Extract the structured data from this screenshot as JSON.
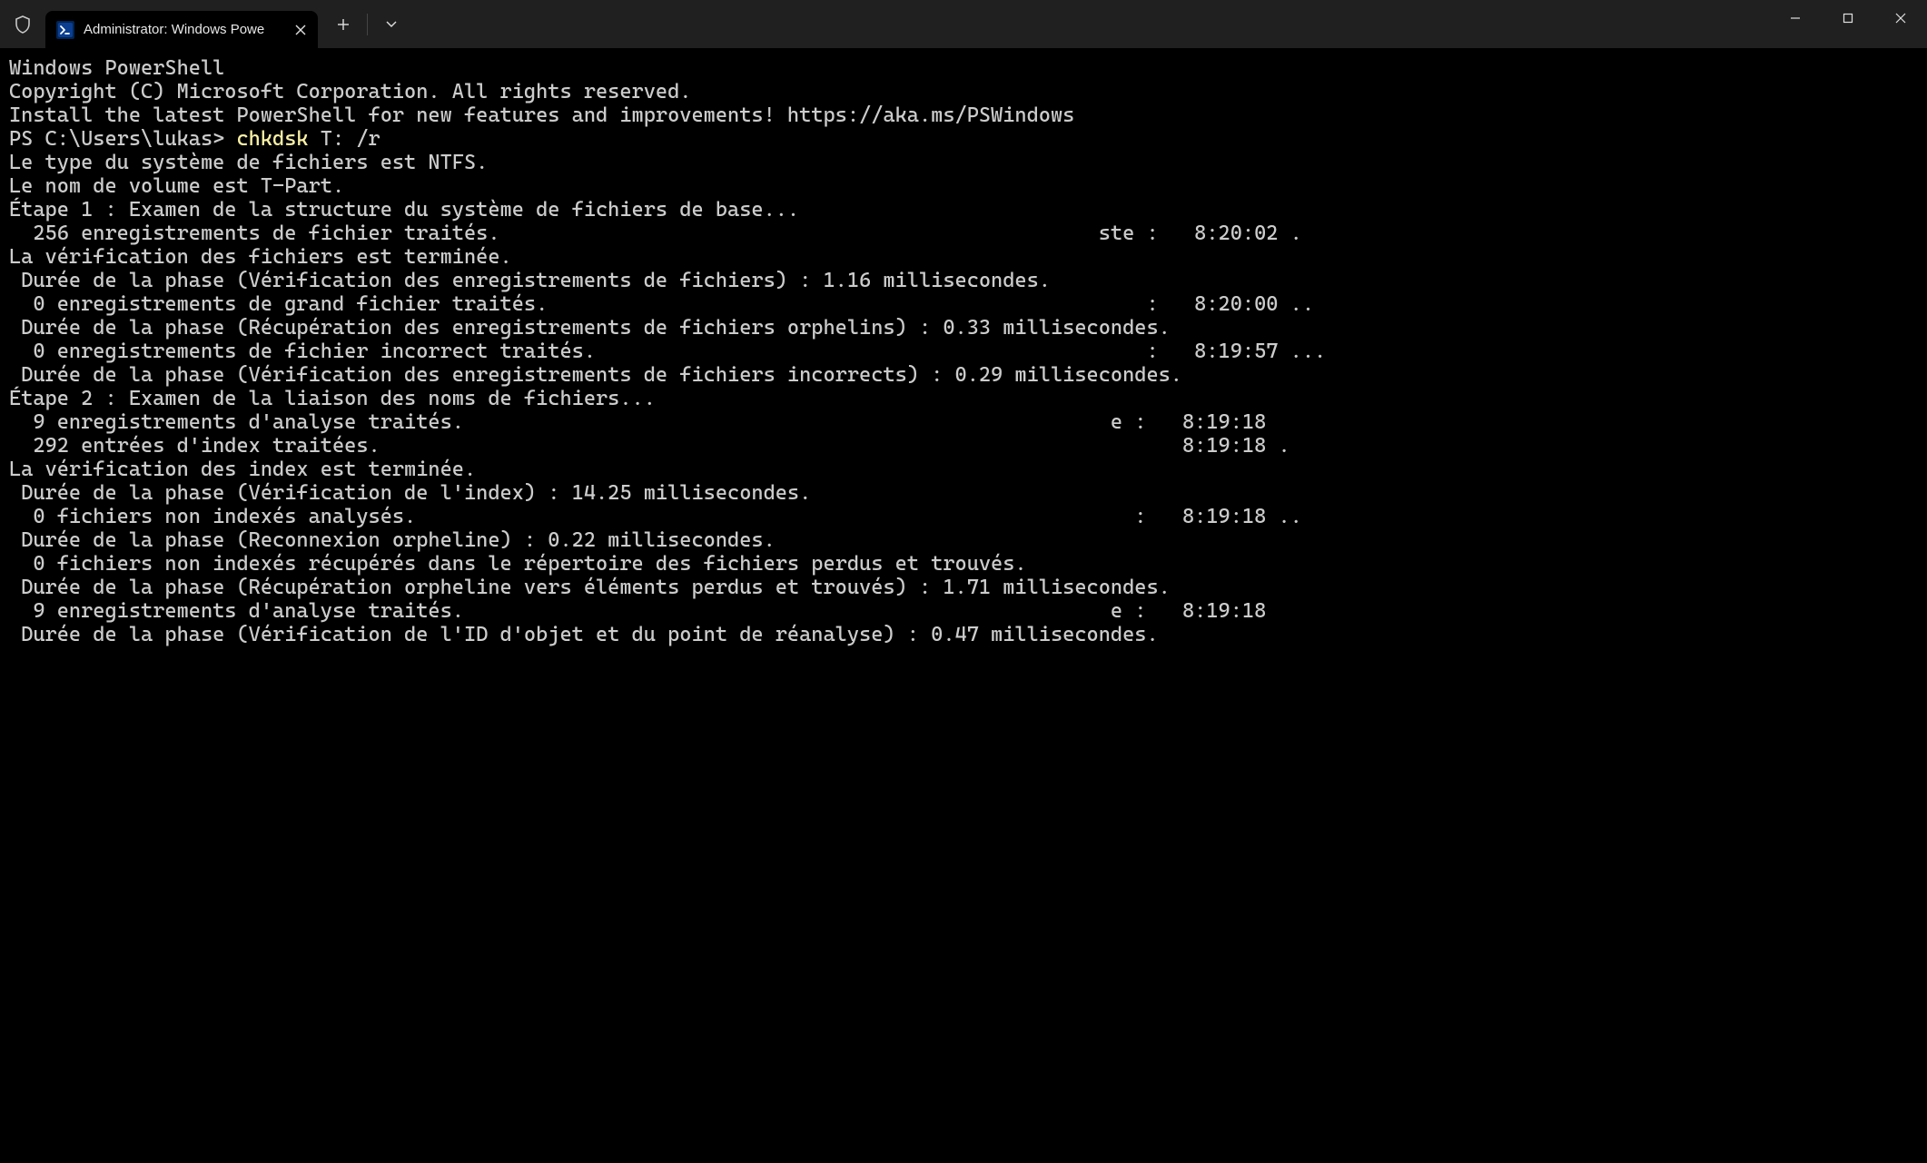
{
  "titlebar": {
    "tab_title": "Administrator: Windows Powe",
    "tab_icon_text": ">_"
  },
  "terminal": {
    "header1": "Windows PowerShell",
    "header2": "Copyright (C) Microsoft Corporation. All rights reserved.",
    "install_hint": "Install the latest PowerShell for new features and improvements! https://aka.ms/PSWindows",
    "prompt": "PS C:\\Users\\lukas> ",
    "command": "chkdsk",
    "command_args": " T: /r",
    "lines": [
      "Le type du système de fichiers est NTFS.",
      "Le nom de volume est T-Part.",
      "",
      "Étape 1 : Examen de la structure du système de fichiers de base...",
      "  256 enregistrements de fichier traités.                                                  ste :   8:20:02 .",
      "La vérification des fichiers est terminée.",
      " Durée de la phase (Vérification des enregistrements de fichiers) : 1.16 millisecondes.",
      "  0 enregistrements de grand fichier traités.                                                  :   8:20:00 ..",
      " Durée de la phase (Récupération des enregistrements de fichiers orphelins) : 0.33 millisecondes.",
      "  0 enregistrements de fichier incorrect traités.                                              :   8:19:57 ...",
      " Durée de la phase (Vérification des enregistrements de fichiers incorrects) : 0.29 millisecondes.",
      "",
      "Étape 2 : Examen de la liaison des noms de fichiers...",
      "  9 enregistrements d'analyse traités.                                                      e :   8:19:18",
      "  292 entrées d'index traitées.                                                                   8:19:18 .",
      "La vérification des index est terminée.",
      " Durée de la phase (Vérification de l'index) : 14.25 millisecondes.",
      "  0 fichiers non indexés analysés.                                                            :   8:19:18 ..",
      " Durée de la phase (Reconnexion orpheline) : 0.22 millisecondes.",
      "  0 fichiers non indexés récupérés dans le répertoire des fichiers perdus et trouvés.",
      " Durée de la phase (Récupération orpheline vers éléments perdus et trouvés) : 1.71 millisecondes.",
      "  9 enregistrements d'analyse traités.                                                      e :   8:19:18",
      " Durée de la phase (Vérification de l'ID d'objet et du point de réanalyse) : 0.47 millisecondes."
    ]
  }
}
